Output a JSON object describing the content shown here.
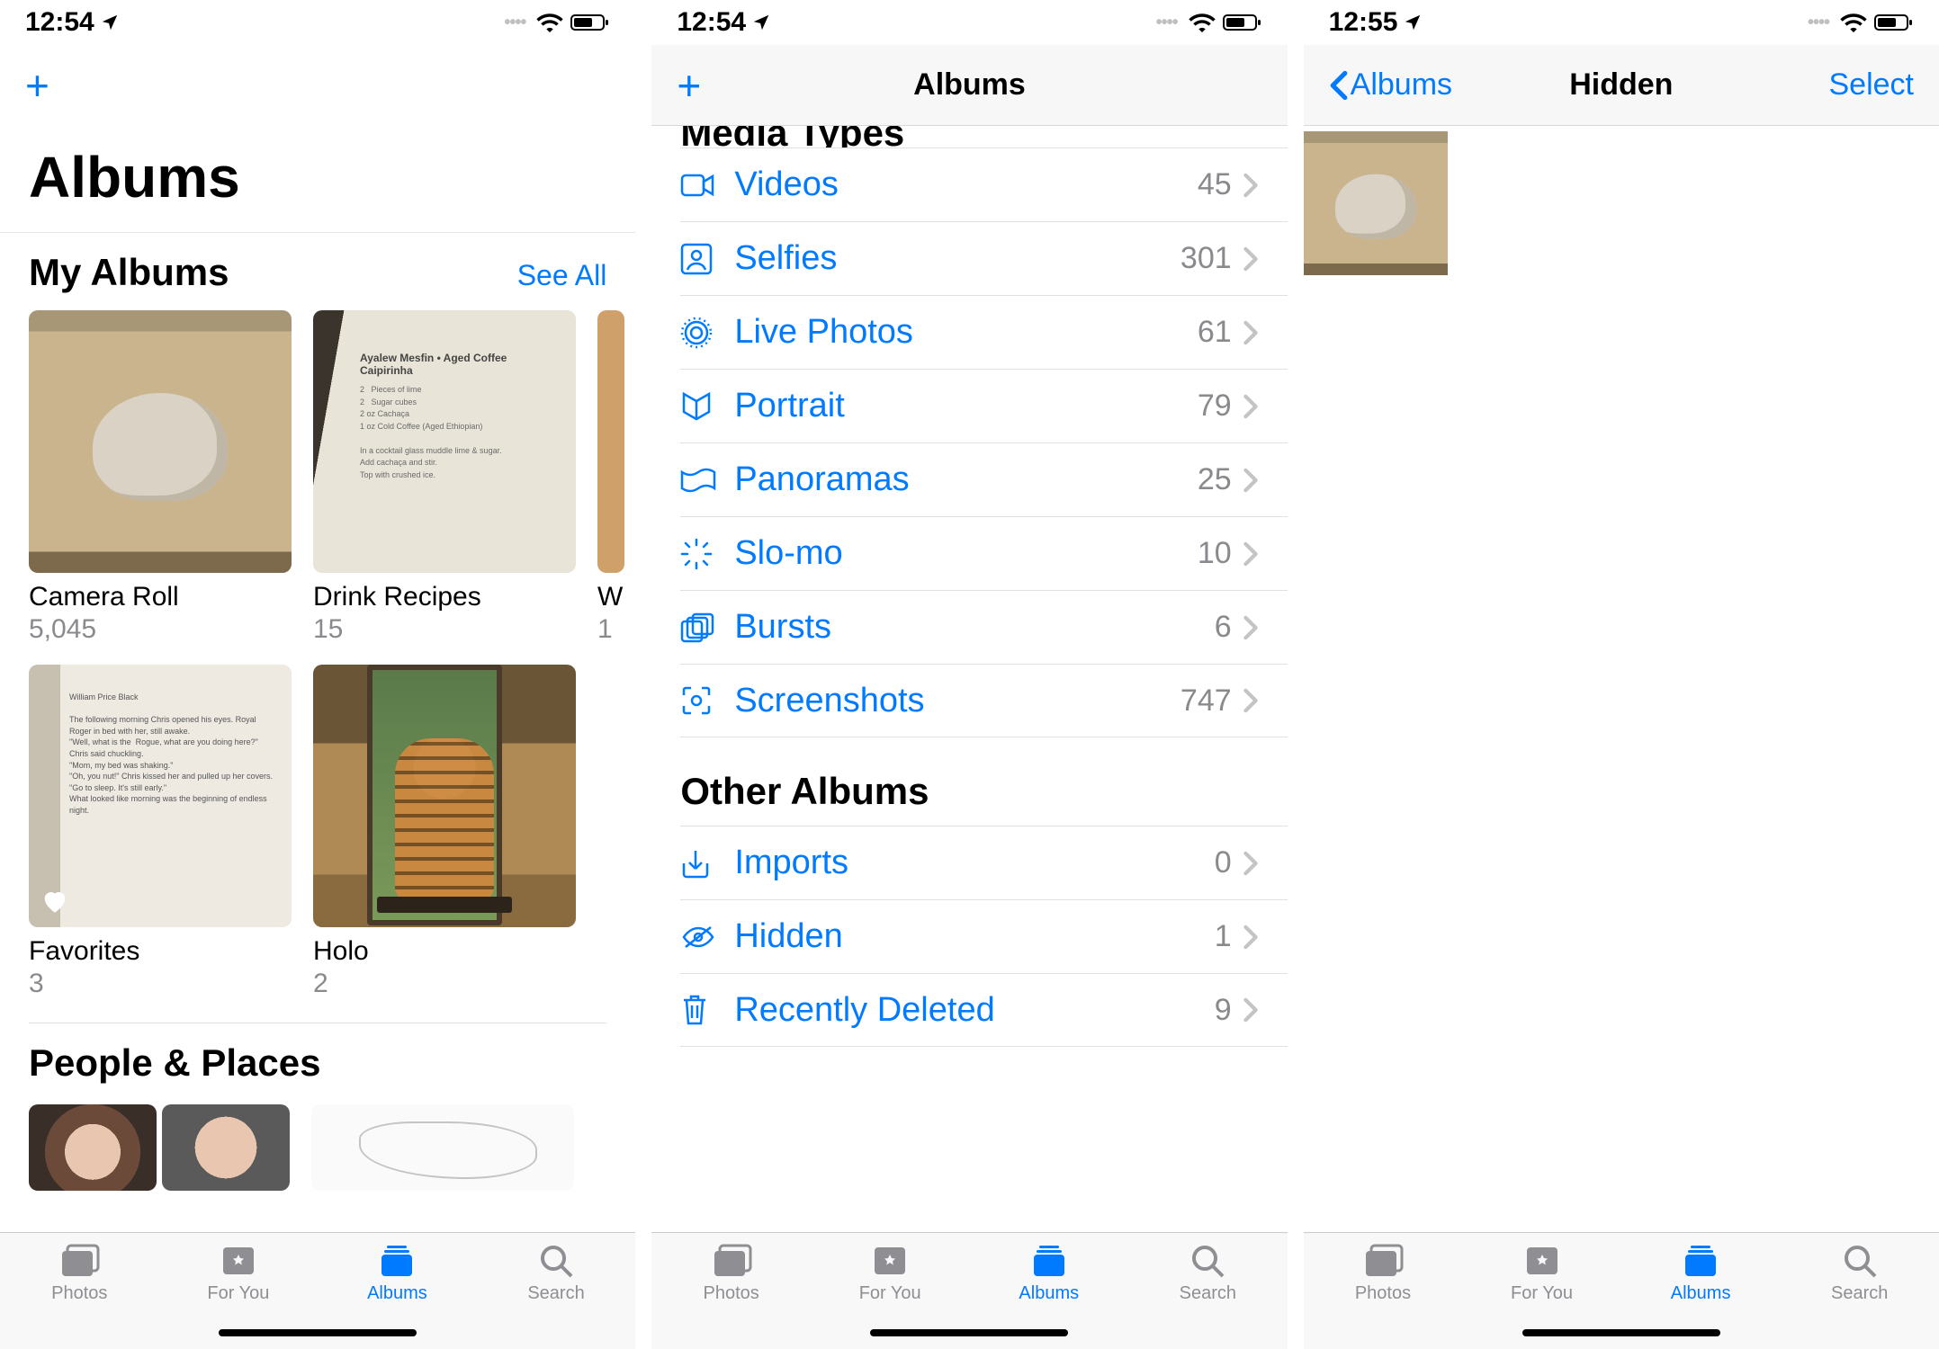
{
  "ios_blue": "#007aff",
  "screen1": {
    "status": {
      "time": "12:54"
    },
    "nav": {
      "large_title": "Albums"
    },
    "my_albums": {
      "header": "My Albums",
      "see_all": "See All",
      "items": [
        {
          "title": "Camera Roll",
          "count": "5,045"
        },
        {
          "title": "Drink Recipes",
          "count": "15"
        },
        {
          "title": "W",
          "count": "1"
        },
        {
          "title": "Favorites",
          "count": "3"
        },
        {
          "title": "Holo",
          "count": "2"
        }
      ]
    },
    "people_places": {
      "header": "People & Places"
    },
    "tabs": {
      "photos": "Photos",
      "foryou": "For You",
      "albums": "Albums",
      "search": "Search",
      "active": "albums"
    }
  },
  "screen2": {
    "status": {
      "time": "12:54"
    },
    "nav": {
      "title": "Albums"
    },
    "media_types": {
      "header": "Media Types",
      "rows": [
        {
          "icon": "video-icon",
          "label": "Videos",
          "count": "45"
        },
        {
          "icon": "selfie-icon",
          "label": "Selfies",
          "count": "301"
        },
        {
          "icon": "livephoto-icon",
          "label": "Live Photos",
          "count": "61"
        },
        {
          "icon": "portrait-icon",
          "label": "Portrait",
          "count": "79"
        },
        {
          "icon": "panorama-icon",
          "label": "Panoramas",
          "count": "25"
        },
        {
          "icon": "slomo-icon",
          "label": "Slo-mo",
          "count": "10"
        },
        {
          "icon": "burst-icon",
          "label": "Bursts",
          "count": "6"
        },
        {
          "icon": "screenshot-icon",
          "label": "Screenshots",
          "count": "747"
        }
      ]
    },
    "other_albums": {
      "header": "Other Albums",
      "rows": [
        {
          "icon": "import-icon",
          "label": "Imports",
          "count": "0"
        },
        {
          "icon": "hidden-icon",
          "label": "Hidden",
          "count": "1"
        },
        {
          "icon": "trash-icon",
          "label": "Recently Deleted",
          "count": "9"
        }
      ]
    },
    "tabs": {
      "photos": "Photos",
      "foryou": "For You",
      "albums": "Albums",
      "search": "Search",
      "active": "albums"
    }
  },
  "screen3": {
    "status": {
      "time": "12:55"
    },
    "nav": {
      "back": "Albums",
      "title": "Hidden",
      "right": "Select"
    },
    "tabs": {
      "photos": "Photos",
      "foryou": "For You",
      "albums": "Albums",
      "search": "Search",
      "active": "albums"
    }
  }
}
